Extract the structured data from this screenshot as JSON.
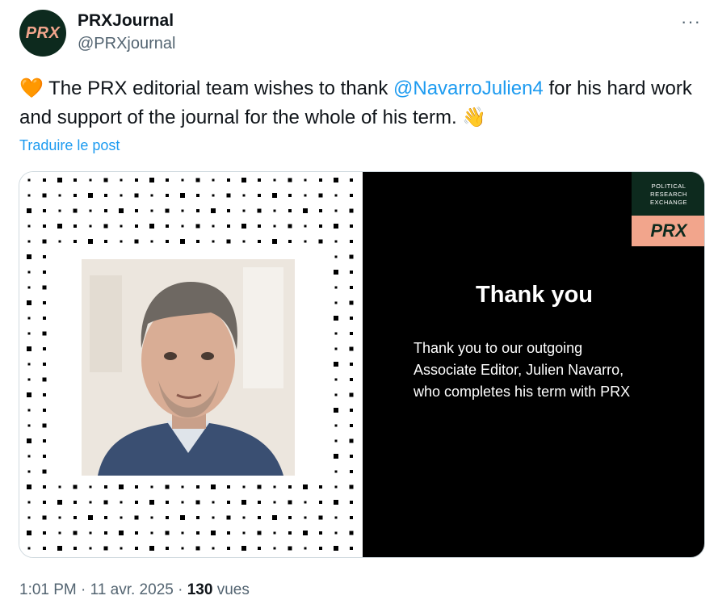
{
  "account": {
    "display_name": "PRXJournal",
    "handle": "@PRXjournal",
    "avatar_text": "PRX",
    "avatar_bg": "#0d2a1e",
    "avatar_fg": "#f2a58c"
  },
  "more_menu": {
    "label": "···"
  },
  "tweet": {
    "emoji_heart": "🧡",
    "text_before": " The PRX editorial team wishes to thank ",
    "mention": "@NavarroJulien4",
    "text_after": " for his hard work and support of the journal for the whole of his term. ",
    "emoji_wave": "👋",
    "mention_color": "#1d9bf0"
  },
  "translate_link": "Traduire le post",
  "media": {
    "logo_line1": "POLITICAL",
    "logo_line2": "RESEARCH",
    "logo_line3": "EXCHANGE",
    "logo_short": "PRX",
    "title": "Thank you",
    "body_line1": "Thank you to our outgoing",
    "body_line2": "Associate Editor, Julien Navarro,",
    "body_line3": "who completes his term with PRX"
  },
  "footer": {
    "time": "1:01 PM",
    "sep1": " · ",
    "date": "11 avr. 2025",
    "sep2": " · ",
    "views_count": "130",
    "views_label": " vues"
  }
}
